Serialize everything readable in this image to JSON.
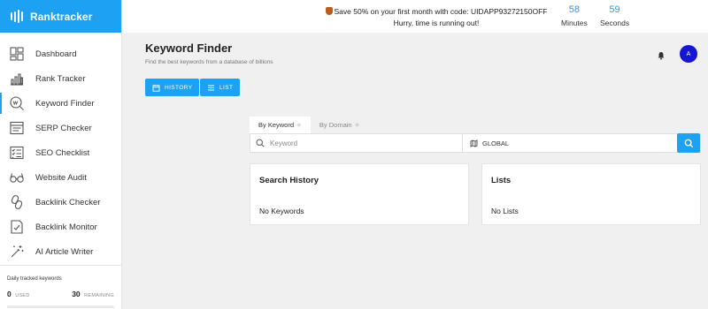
{
  "app": {
    "name": "Ranktracker"
  },
  "promo": {
    "line1": "Save 50% on your first month with code: UIDAPP93272150OFF",
    "line2": "Hurry, time is running out!",
    "minutes_value": "58",
    "minutes_label": "Minutes",
    "seconds_value": "59",
    "seconds_label": "Seconds"
  },
  "sidebar": {
    "items": [
      {
        "label": "Dashboard",
        "icon": "dashboard-icon"
      },
      {
        "label": "Rank Tracker",
        "icon": "bar-chart-icon"
      },
      {
        "label": "Keyword Finder",
        "icon": "keyword-finder-icon",
        "active": true
      },
      {
        "label": "SERP Checker",
        "icon": "serp-icon"
      },
      {
        "label": "SEO Checklist",
        "icon": "checklist-icon"
      },
      {
        "label": "Website Audit",
        "icon": "glasses-icon"
      },
      {
        "label": "Backlink Checker",
        "icon": "link-icon"
      },
      {
        "label": "Backlink Monitor",
        "icon": "monitor-icon"
      },
      {
        "label": "AI Article Writer",
        "icon": "magic-wand-icon"
      }
    ],
    "tracked": {
      "title": "Daily tracked keywords",
      "used_value": "0",
      "used_label": "USED",
      "remaining_value": "30",
      "remaining_label": "REMAINING",
      "used_fraction": 0
    }
  },
  "header": {
    "title": "Keyword Finder",
    "subtitle": "Find the best keywords from a database of billions",
    "avatar_initial": "A"
  },
  "toolbar": {
    "history_label": "HISTORY",
    "list_label": "LIST"
  },
  "search": {
    "tabs": [
      {
        "label": "By Keyword",
        "active": true
      },
      {
        "label": "By Domain",
        "active": false
      }
    ],
    "keyword_placeholder": "Keyword",
    "location": "GLOBAL"
  },
  "cards": {
    "history": {
      "title": "Search History",
      "body": "No Keywords"
    },
    "lists": {
      "title": "Lists",
      "body": "No Lists"
    }
  },
  "colors": {
    "accent": "#1da1f2",
    "avatar": "#1515d6",
    "promo_badge": "#c05a1c"
  }
}
